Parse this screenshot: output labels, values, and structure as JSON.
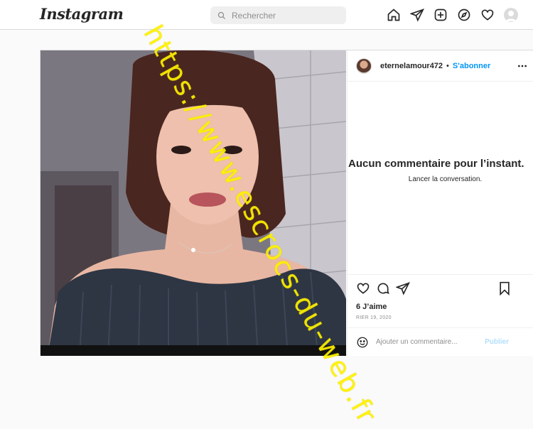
{
  "header": {
    "logo": "Instagram",
    "search_placeholder": "Rechercher",
    "nav_icons": [
      "home-icon",
      "direct-icon",
      "new-post-icon",
      "explore-icon",
      "activity-icon",
      "profile-avatar"
    ]
  },
  "post": {
    "username": "eternelamour472",
    "separator": "•",
    "follow_label": "S'abonner",
    "empty_title": "Aucun commentaire pour l’instant.",
    "empty_subtitle": "Lancer la conversation.",
    "likes": "6 J’aime",
    "date": "RIER 19, 2020",
    "comment_placeholder": "Ajouter un commentaire...",
    "publish_label": "Publier"
  },
  "watermark": "https://www.escrocs-du-web.fr",
  "colors": {
    "accent": "#0095f6",
    "publish_disabled": "#b2dffc",
    "watermark": "#fff200"
  }
}
